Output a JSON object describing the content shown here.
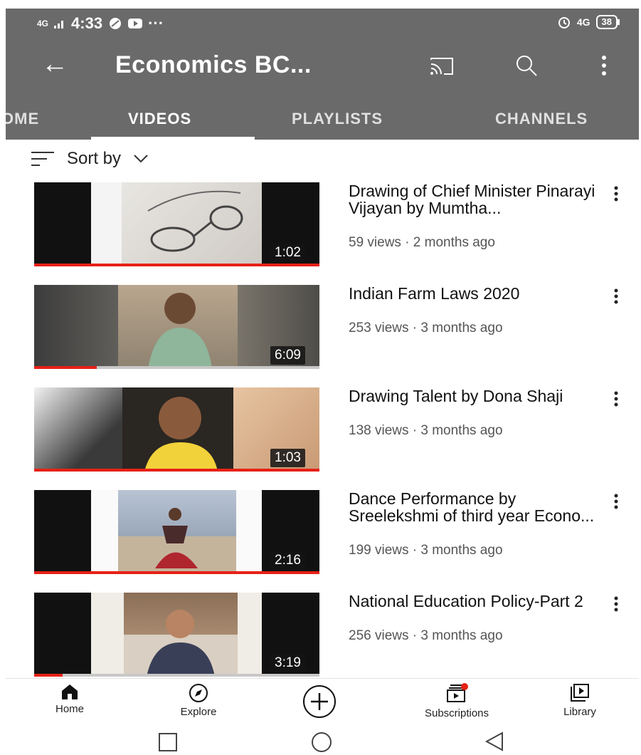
{
  "status_bar": {
    "network": "4G",
    "time": "4:33",
    "right_network": "4G",
    "battery": "38"
  },
  "app_bar": {
    "title": "Economics BC...",
    "back_icon": "arrow-left-icon",
    "cast_icon": "cast-icon",
    "search_icon": "search-icon",
    "more_icon": "more-vert-icon"
  },
  "tabs": [
    {
      "label": "OME"
    },
    {
      "label": "VIDEOS",
      "active": true
    },
    {
      "label": "PLAYLISTS"
    },
    {
      "label": "CHANNELS"
    }
  ],
  "sort": {
    "label": "Sort by"
  },
  "videos": [
    {
      "title": "Drawing of Chief Minister Pinarayi Vijayan by Mumtha...",
      "meta": "59 views · 2 months ago",
      "duration": "1:02",
      "progress": 1.0
    },
    {
      "title": "Indian Farm Laws 2020",
      "meta": "253 views · 3 months ago",
      "duration": "6:09",
      "progress": 0.22
    },
    {
      "title": "Drawing Talent by Dona Shaji",
      "meta": "138 views · 3 months ago",
      "duration": "1:03",
      "progress": 1.0
    },
    {
      "title": "Dance Performance by Sreelekshmi of third year Econo...",
      "meta": "199 views · 3 months ago",
      "duration": "2:16",
      "progress": 1.0
    },
    {
      "title": "National Education Policy-Part 2",
      "meta": "256 views · 3 months ago",
      "duration": "3:19",
      "progress": 0.1
    }
  ],
  "bottom_nav": {
    "home": "Home",
    "explore": "Explore",
    "subscriptions": "Subscriptions",
    "library": "Library"
  },
  "colors": {
    "header": "#6a6a6a",
    "progress": "#e62117",
    "badge": "#e62117"
  }
}
